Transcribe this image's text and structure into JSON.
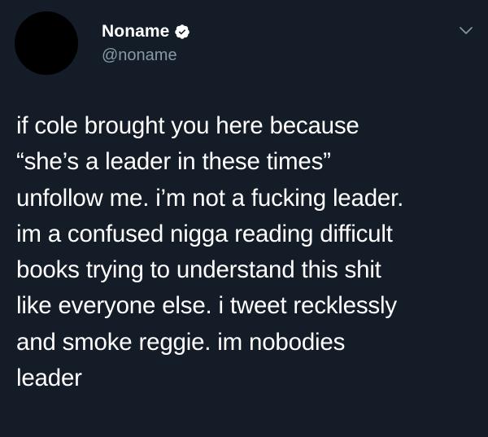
{
  "tweet": {
    "display_name": "Noname",
    "handle": "@noname",
    "verified": true,
    "text": "if cole brought you here because\n“she’s a leader in these times”\nunfollow me. i’m not a fucking leader.\nim a confused nigga reading difficult\nbooks trying to understand this shit\nlike everyone else. i tweet recklessly\nand smoke reggie. im nobodies\nleader"
  },
  "icons": {
    "verified": "verified-badge-icon",
    "menu": "chevron-down-icon"
  },
  "colors": {
    "background": "#141c27",
    "text": "#ffffff",
    "secondary_text": "#8899a6",
    "avatar": "#000000"
  }
}
